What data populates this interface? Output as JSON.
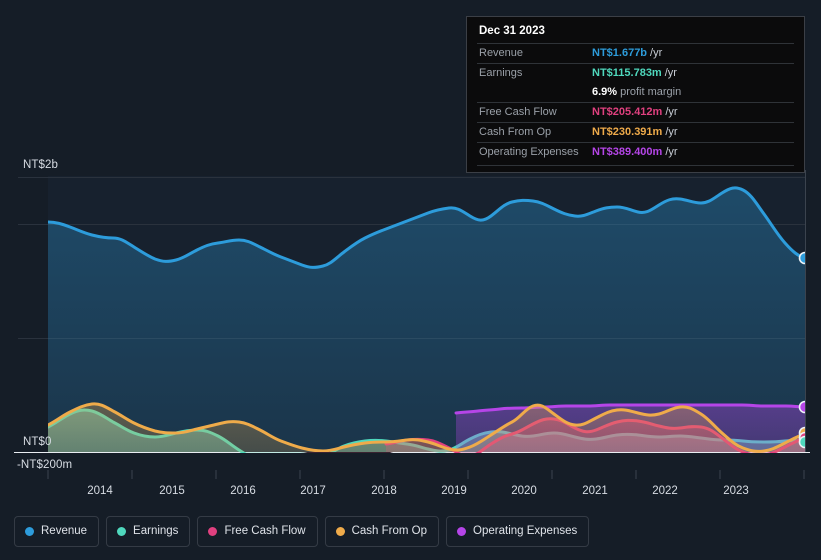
{
  "tooltip": {
    "title": "Dec 31 2023",
    "rows": [
      {
        "label": "Revenue",
        "value": "NT$1.677b",
        "unit": "/yr",
        "color": "#2d9cdb"
      },
      {
        "label": "Earnings",
        "value": "NT$115.783m",
        "unit": "/yr",
        "color": "#4fd8bd"
      },
      {
        "label": "",
        "value": "6.9%",
        "sub": "profit margin",
        "color": "#ffffff"
      },
      {
        "label": "Free Cash Flow",
        "value": "NT$205.412m",
        "unit": "/yr",
        "color": "#e0407f"
      },
      {
        "label": "Cash From Op",
        "value": "NT$230.391m",
        "unit": "/yr",
        "color": "#efab4a"
      },
      {
        "label": "Operating Expenses",
        "value": "NT$389.400m",
        "unit": "/yr",
        "color": "#b545e8"
      }
    ]
  },
  "legend": {
    "items": [
      {
        "label": "Revenue",
        "color": "#2d9cdb"
      },
      {
        "label": "Earnings",
        "color": "#4fd8bd"
      },
      {
        "label": "Free Cash Flow",
        "color": "#e0407f"
      },
      {
        "label": "Cash From Op",
        "color": "#efab4a"
      },
      {
        "label": "Operating Expenses",
        "color": "#b545e8"
      }
    ]
  },
  "axes": {
    "y_top_label": "NT$2b",
    "y_zero_label": "NT$0",
    "y_neg_label": "-NT$200m",
    "x_tick_labels": [
      "2014",
      "2015",
      "2016",
      "2017",
      "2018",
      "2019",
      "2020",
      "2021",
      "2022",
      "2023"
    ]
  },
  "chart_data": {
    "type": "area",
    "title": "",
    "xlabel": "",
    "ylabel": "NT$",
    "ylim": [
      -200000000,
      2400000000
    ],
    "y_ticks": [
      2000000000,
      0,
      -200000000
    ],
    "y_tick_labels": [
      "NT$2b",
      "NT$0",
      "-NT$200m"
    ],
    "grid": true,
    "legend_position": "bottom-left",
    "x_range": [
      "2013-06",
      "2023-12"
    ],
    "x": [
      "2013.4",
      "2013.7",
      "2014.0",
      "2014.3",
      "2014.6",
      "2014.9",
      "2015.2",
      "2015.5",
      "2015.8",
      "2016.1",
      "2016.4",
      "2016.7",
      "2017.0",
      "2017.3",
      "2017.6",
      "2017.9",
      "2018.2",
      "2018.5",
      "2018.8",
      "2019.1",
      "2019.4",
      "2019.7",
      "2020.0",
      "2020.3",
      "2020.6",
      "2020.9",
      "2021.2",
      "2021.5",
      "2021.8",
      "2022.1",
      "2022.4",
      "2022.7",
      "2023.0",
      "2023.3",
      "2023.6",
      "2023.9"
    ],
    "series": [
      {
        "name": "Revenue",
        "color": "#2d9cdb",
        "units": "NT$",
        "last_value": "NT$1.677b",
        "values": [
          2000,
          1960,
          1880,
          1820,
          1760,
          1700,
          1720,
          1700,
          1640,
          1700,
          1740,
          1700,
          1660,
          1680,
          1620,
          1560,
          1620,
          1720,
          1800,
          1860,
          1940,
          1980,
          2050,
          2120,
          2080,
          2100,
          2180,
          2260,
          2140,
          2160,
          2230,
          2280,
          2360,
          2300,
          2000,
          1677
        ]
      },
      {
        "name": "Earnings",
        "color": "#4fd8bd",
        "units": "NT$",
        "last_value": "NT$115.783m",
        "values": [
          180,
          240,
          250,
          215,
          185,
          170,
          165,
          180,
          195,
          200,
          180,
          120,
          40,
          -55,
          -85,
          -80,
          -50,
          30,
          60,
          55,
          45,
          20,
          75,
          140,
          160,
          125,
          140,
          165,
          150,
          150,
          140,
          150,
          130,
          125,
          120,
          116
        ]
      },
      {
        "name": "Free Cash Flow",
        "color": "#e0407f",
        "units": "NT$",
        "last_value": "NT$205.412m",
        "values": [
          null,
          null,
          null,
          null,
          null,
          null,
          null,
          null,
          null,
          null,
          null,
          null,
          null,
          null,
          null,
          null,
          30,
          65,
          70,
          60,
          15,
          -20,
          95,
          230,
          290,
          210,
          250,
          300,
          265,
          275,
          250,
          240,
          75,
          25,
          95,
          205
        ]
      },
      {
        "name": "Cash From Op",
        "color": "#efab4a",
        "units": "NT$",
        "last_value": "NT$230.391m",
        "values": [
          200,
          265,
          270,
          235,
          230,
          160,
          100,
          35,
          85,
          130,
          175,
          205,
          195,
          150,
          90,
          50,
          60,
          95,
          100,
          90,
          55,
          25,
          160,
          320,
          255,
          290,
          340,
          300,
          285,
          300,
          350,
          310,
          100,
          45,
          110,
          230
        ]
      },
      {
        "name": "Operating Expenses",
        "color": "#b545e8",
        "units": "NT$",
        "last_value": "NT$389.400m",
        "values": [
          null,
          null,
          null,
          null,
          null,
          null,
          null,
          null,
          null,
          null,
          null,
          null,
          null,
          null,
          null,
          null,
          null,
          null,
          null,
          330,
          345,
          355,
          365,
          375,
          380,
          380,
          382,
          385,
          385,
          388,
          390,
          390,
          390,
          390,
          390,
          389
        ]
      }
    ]
  }
}
